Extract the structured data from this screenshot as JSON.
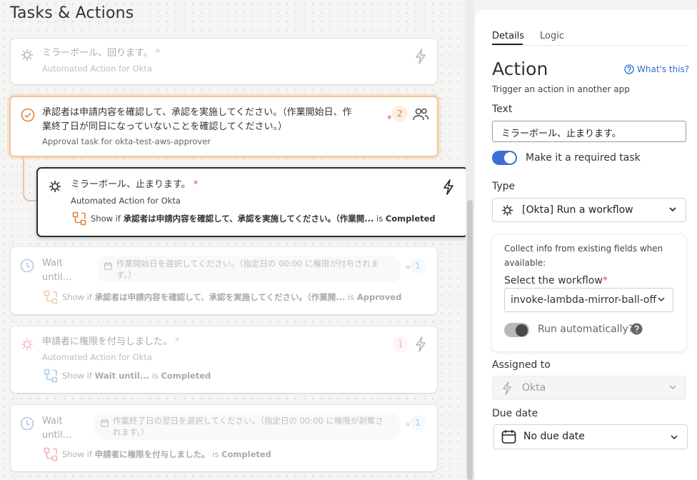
{
  "page_title": "Tasks & Actions",
  "tasks": [
    {
      "title": "ミラーボール、回ります。",
      "required_mark": "*",
      "subtitle": "Automated Action for Okta",
      "icon": "okta-icon",
      "action_icon": "lightning-icon"
    },
    {
      "title_line1": "承認者は申請内容を確認して、承認を実施してください。（作業開始日、作",
      "title_line2": "業終了日が同日になっていないことを確認してください。）",
      "required_mark": "*",
      "subtitle": "Approval task for okta-test-aws-approver",
      "badge": "2",
      "icon": "check-circle-icon",
      "action_icon": "users-icon"
    },
    {
      "title": "ミラーボール、止まります。",
      "required_mark": "*",
      "subtitle": "Automated Action for Okta",
      "condition_prefix": "Show if",
      "condition_task": "承認者は申請内容を確認して、承認を実施してください。（作業開...",
      "condition_is": "is",
      "condition_state": "Completed",
      "icon": "okta-icon",
      "action_icon": "lightning-icon"
    },
    {
      "title_line1": "Wait",
      "title_line2": "until...",
      "pill_line1": "作業開始日を選択してください。（指定日の 00:00 に権限が付与されま",
      "pill_line2": "す。）",
      "required_mark": "*",
      "badge": "1",
      "condition_prefix": "Show if",
      "condition_task": "承認者は申請内容を確認して、承認を実施してください。（作業開...",
      "condition_is": "is",
      "condition_state": "Approved",
      "icon": "clock-icon"
    },
    {
      "title": "申請者に権限を付与しました。",
      "required_mark": "*",
      "subtitle": "Automated Action for Okta",
      "badge": "1",
      "condition_prefix": "Show if",
      "condition_task": "Wait until...",
      "condition_is": "is",
      "condition_state": "Completed",
      "icon": "okta-icon",
      "action_icon": "lightning-icon"
    },
    {
      "title_line1": "Wait",
      "title_line2": "until...",
      "pill_line1": "作業終了日の翌日を選択してください。（指定日の 00:00 に権限が剥奪さ",
      "pill_line2": "れます。）",
      "required_mark": "*",
      "badge": "1",
      "condition_prefix": "Show if",
      "condition_task": "申請者に権限を付与しました。",
      "condition_is": "is",
      "condition_state": "Completed",
      "icon": "clock-icon"
    }
  ],
  "panel": {
    "tabs": [
      "Details",
      "Logic"
    ],
    "active_tab": "Details",
    "heading": "Action",
    "whats_this": "What's this?",
    "description": "Trigger an action in another app",
    "text_label": "Text",
    "text_value": "ミラーボール、止まります。",
    "required_toggle_label": "Make it a required task",
    "required_toggle_on": true,
    "type_label": "Type",
    "type_value": "[Okta] Run a workflow",
    "collect_info": "Collect info from existing fields when available:",
    "workflow_label": "Select the workflow",
    "workflow_required_mark": "*",
    "workflow_value": "invoke-lambda-mirror-ball-off",
    "run_auto_label": "Run automatically?",
    "run_auto_on": false,
    "assigned_label": "Assigned to",
    "assigned_value": "Okta",
    "due_label": "Due date",
    "due_value": "No due date"
  },
  "colors": {
    "accent_blue": "#3b6fd8",
    "approval_orange": "#e0863a",
    "required_red": "#e04a55",
    "link_blue": "#2f6bd6"
  }
}
